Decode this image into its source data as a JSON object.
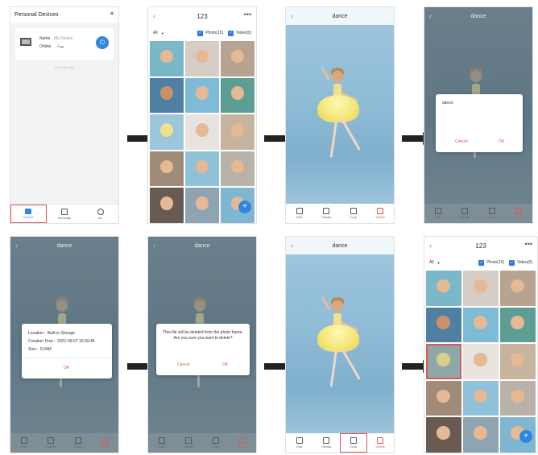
{
  "devices_screen": {
    "title": "Personal Devices",
    "add_icon": "plus-icon",
    "device_name_label": "Name",
    "device_name": "My Device",
    "device_status": "Online",
    "no_more": "No more data",
    "nav": [
      "Device",
      "Message",
      "Me"
    ]
  },
  "gallery": {
    "title": "123",
    "filter": "All",
    "photo_label": "Photo(15)",
    "video_label": "Video(0)"
  },
  "viewer": {
    "title": "dance",
    "actions": [
      "Edit",
      "Details",
      "Crop",
      "Delete"
    ]
  },
  "rename_dialog": {
    "value": "dance",
    "cancel": "Cancel",
    "ok": "OK"
  },
  "details_dialog": {
    "location": "Location：Built-in Storage",
    "creation_time": "Creation Time：2021-09-07 16:39:46",
    "size": "Size：0.04M",
    "ok": "OK"
  },
  "delete_dialog": {
    "message": "This file will be deleted from the photo frame. Are you sure you want to delete?",
    "cancel": "Cancel",
    "ok": "OK"
  },
  "colors": {
    "accent": "#2f7bd6",
    "delete": "#e05555",
    "highlight": "#e05555"
  }
}
